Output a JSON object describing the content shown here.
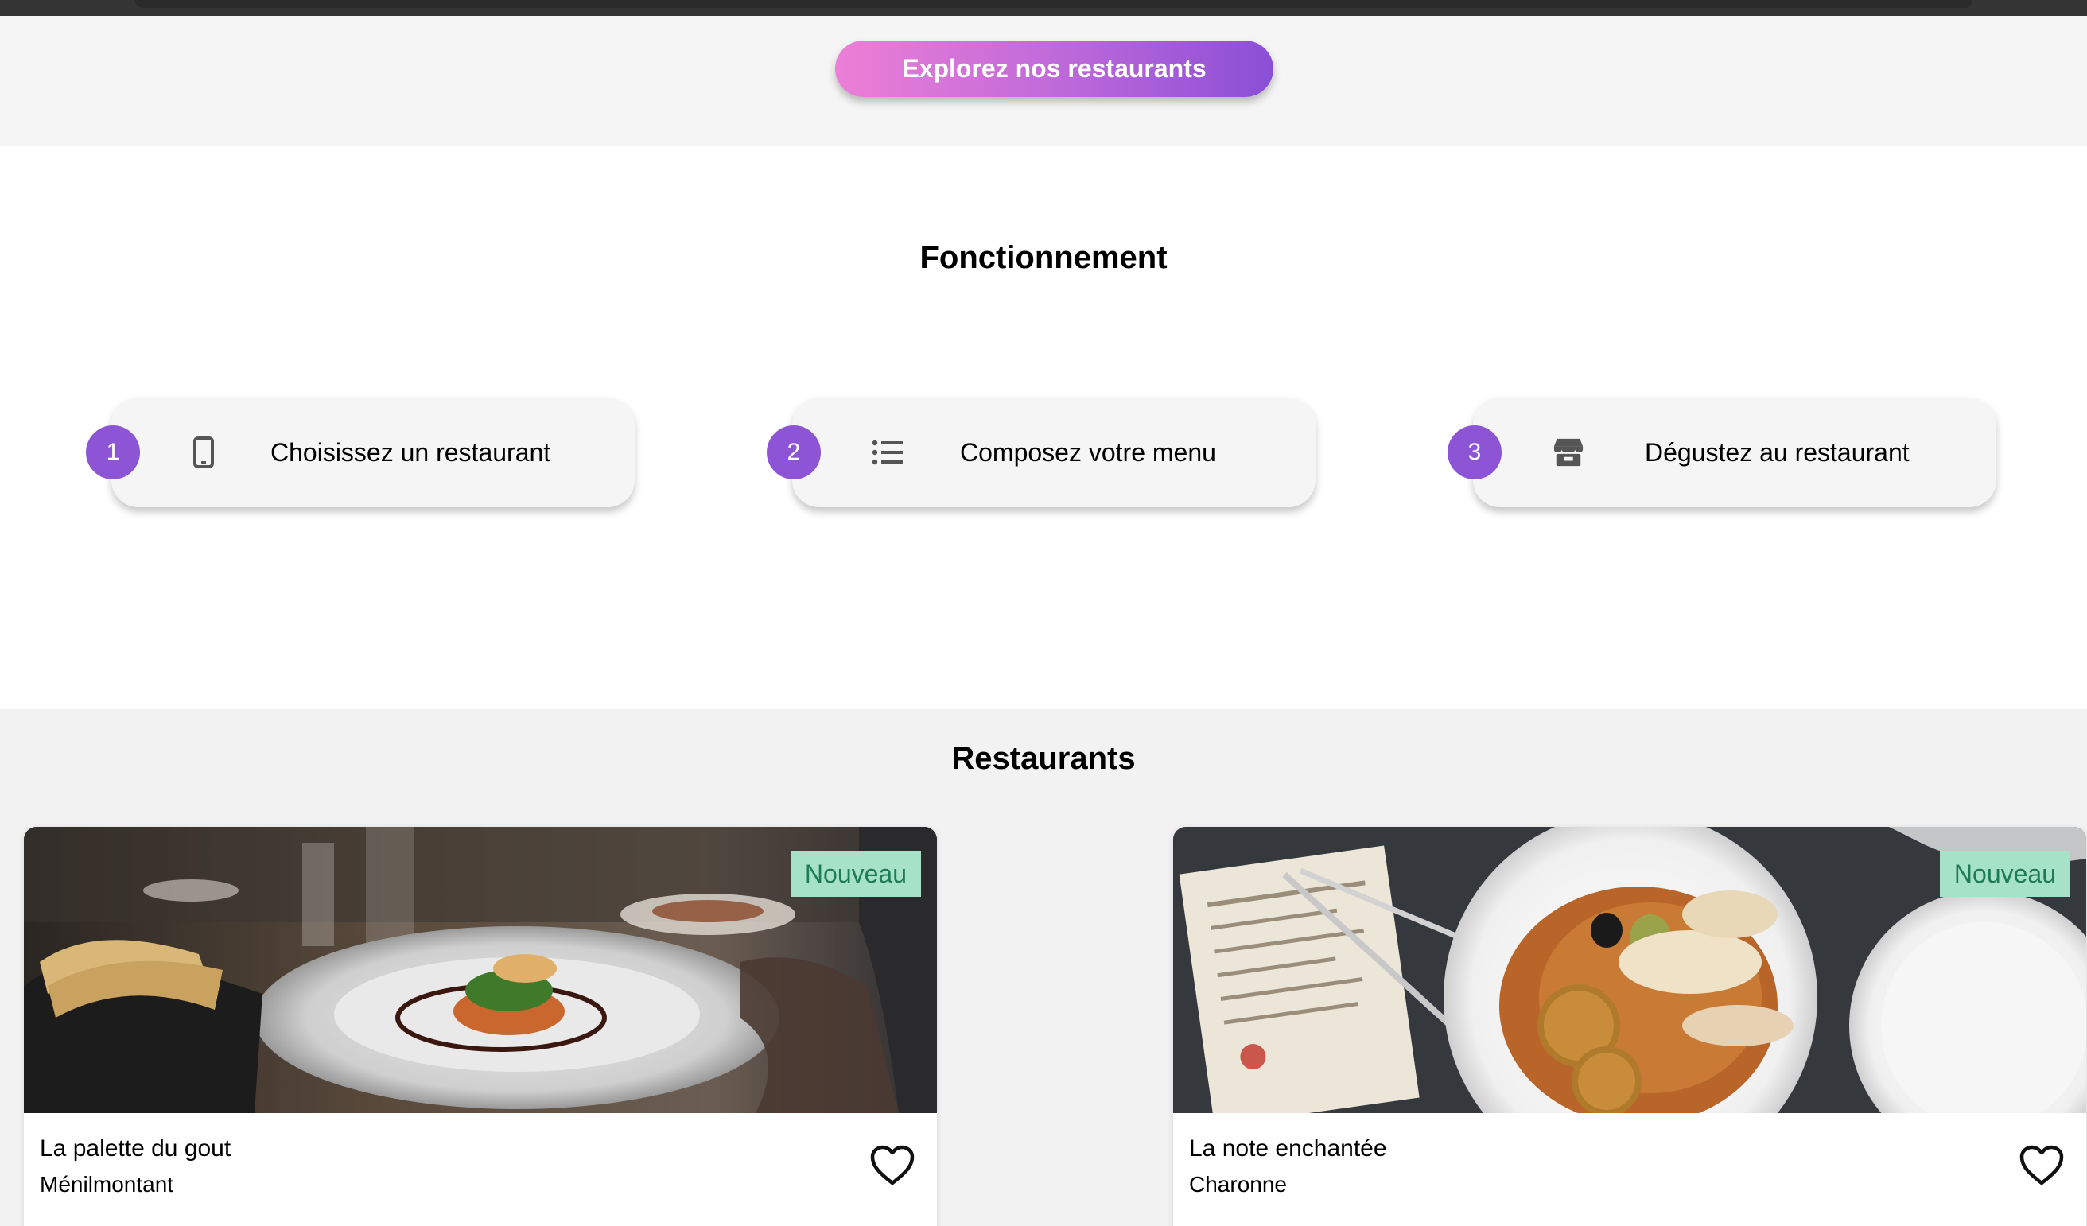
{
  "hero": {
    "cta_label": "Explorez nos restaurants"
  },
  "how_it_works": {
    "title": "Fonctionnement",
    "steps": [
      {
        "number": "1",
        "icon": "smartphone-icon",
        "label": "Choisissez un restaurant"
      },
      {
        "number": "2",
        "icon": "list-icon",
        "label": "Composez votre menu"
      },
      {
        "number": "3",
        "icon": "storefront-icon",
        "label": "Dégustez au restaurant"
      }
    ]
  },
  "restaurants": {
    "title": "Restaurants",
    "items": [
      {
        "name": "La palette du gout",
        "area": "Ménilmontant",
        "badge": "Nouveau",
        "favorite_icon": "heart-outline-icon"
      },
      {
        "name": "La note enchantée",
        "area": "Charonne",
        "badge": "Nouveau",
        "favorite_icon": "heart-outline-icon"
      }
    ]
  },
  "colors": {
    "accent_purple": "#8d55d6",
    "cta_gradient_start": "#ec7fd6",
    "cta_gradient_end": "#8a4fd6",
    "badge_bg": "#a6e2c8",
    "badge_text": "#1f7a56"
  }
}
